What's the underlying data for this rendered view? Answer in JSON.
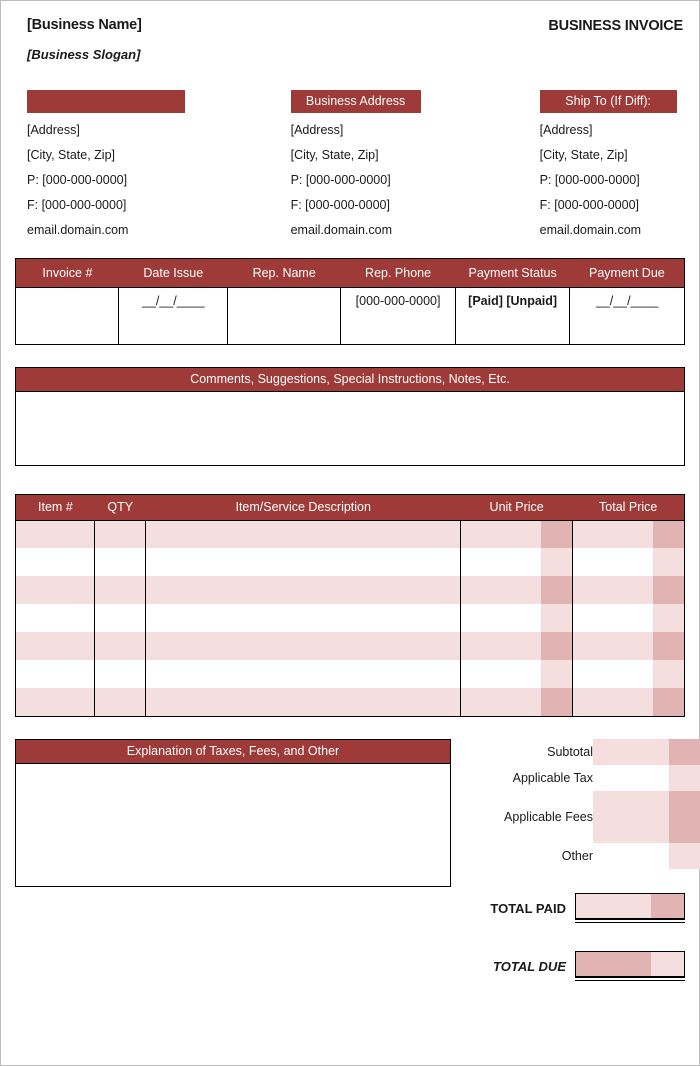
{
  "theme": {
    "accent": "#9e3b38",
    "tint_light": "#f4dede",
    "tint_dark": "#e2b3b3",
    "border": "#000000",
    "page_border": "#bdbdbd"
  },
  "header": {
    "business_name": "[Business Name]",
    "business_slogan": "[Business Slogan]",
    "document_title": "BUSINESS INVOICE"
  },
  "addresses": [
    {
      "heading": "",
      "lines": [
        "[Address]",
        "[City, State, Zip]",
        "P: [000-000-0000]",
        "F: [000-000-0000]",
        "email.domain.com"
      ]
    },
    {
      "heading": "Business  Address",
      "lines": [
        "[Address]",
        "[City, State, Zip]",
        "P: [000-000-0000]",
        "F: [000-000-0000]",
        "email.domain.com"
      ]
    },
    {
      "heading": "Ship To (If Diff):",
      "lines": [
        "[Address]",
        "[City, State, Zip]",
        "P: [000-000-0000]",
        "F: [000-000-0000]",
        "email.domain.com"
      ]
    }
  ],
  "invoice_info": {
    "columns": [
      "Invoice #",
      "Date Issue",
      "Rep. Name",
      "Rep. Phone",
      "Payment Status",
      "Payment Due"
    ],
    "values": {
      "invoice_number": "",
      "date_issue": "__/__/____",
      "rep_name": "",
      "rep_phone": "[000-000-0000]",
      "payment_status": "[Paid] [Unpaid]",
      "payment_due": "__/__/____"
    }
  },
  "comments": {
    "heading": "Comments, Suggestions,  Special Instructions,  Notes, Etc.",
    "value": ""
  },
  "items": {
    "columns": [
      "Item #",
      "QTY",
      "Item/Service Description",
      "Unit Price",
      "Total Price"
    ],
    "rows": [
      {
        "item_no": "",
        "qty": "",
        "description": "",
        "unit_price": "",
        "total_price": "",
        "tint": "a"
      },
      {
        "item_no": "",
        "qty": "",
        "description": "",
        "unit_price": "",
        "total_price": "",
        "tint": "b"
      },
      {
        "item_no": "",
        "qty": "",
        "description": "",
        "unit_price": "",
        "total_price": "",
        "tint": "a"
      },
      {
        "item_no": "",
        "qty": "",
        "description": "",
        "unit_price": "",
        "total_price": "",
        "tint": "b"
      },
      {
        "item_no": "",
        "qty": "",
        "description": "",
        "unit_price": "",
        "total_price": "",
        "tint": "a"
      },
      {
        "item_no": "",
        "qty": "",
        "description": "",
        "unit_price": "",
        "total_price": "",
        "tint": "b"
      },
      {
        "item_no": "",
        "qty": "",
        "description": "",
        "unit_price": "",
        "total_price": "",
        "tint": "a"
      }
    ]
  },
  "explanation": {
    "heading": "Explanation  of Taxes, Fees, and Other",
    "value": ""
  },
  "totals": {
    "rows": [
      {
        "label": "Subtotal",
        "value": "",
        "tint": "a"
      },
      {
        "label": "Applicable Tax",
        "value": "",
        "tint": "b"
      },
      {
        "label": "Applicable Fees",
        "value": "",
        "tint": "a"
      },
      {
        "label": "Other",
        "value": "",
        "tint": "b"
      }
    ],
    "total_paid": {
      "label": "TOTAL PAID",
      "value": ""
    },
    "total_due": {
      "label": "TOTAL DUE",
      "value": ""
    }
  }
}
